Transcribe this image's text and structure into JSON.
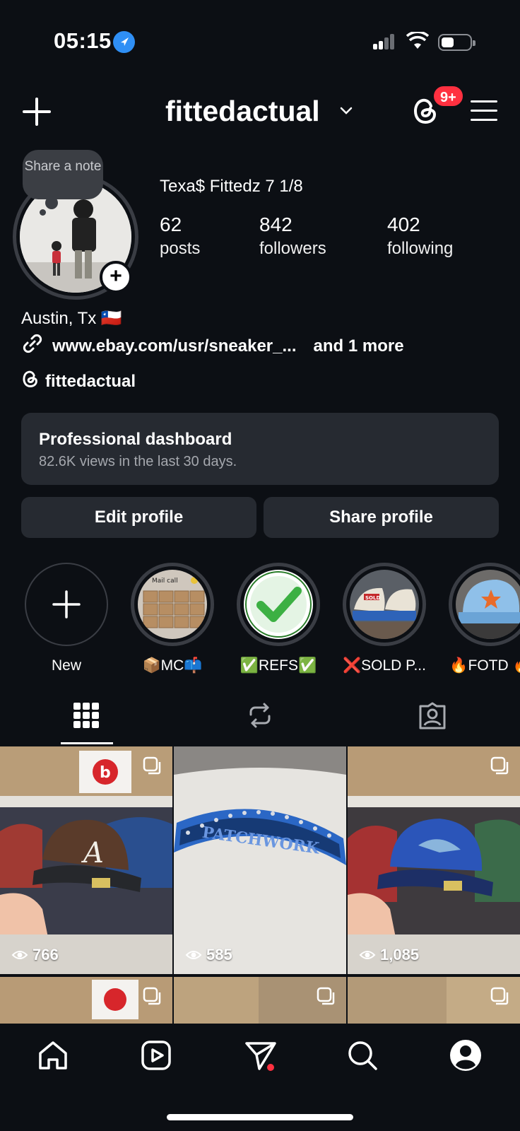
{
  "status_bar": {
    "time": "05:15"
  },
  "header": {
    "username": "fittedactual",
    "notification_badge": "9+"
  },
  "profile": {
    "note_bubble": "Share a note",
    "display_name": "Texa$ Fittedz 7 1/8",
    "stats": [
      {
        "value": "62",
        "label": "posts"
      },
      {
        "value": "842",
        "label": "followers"
      },
      {
        "value": "402",
        "label": "following"
      }
    ],
    "location": "Austin, Tx 🇨🇱",
    "link": "www.ebay.com/usr/sneaker_...",
    "link_more": "and 1 more",
    "threads_handle": "fittedactual"
  },
  "dashboard": {
    "title": "Professional dashboard",
    "subtitle": "82.6K views in the last 30 days."
  },
  "buttons": {
    "edit": "Edit profile",
    "share": "Share profile"
  },
  "highlights": [
    {
      "label": "New"
    },
    {
      "label": "📦MC📫"
    },
    {
      "label": "✅REFS✅"
    },
    {
      "label": "❌SOLD P..."
    },
    {
      "label": "🔥FOTD 🔥"
    }
  ],
  "posts": [
    {
      "views": "766"
    },
    {
      "views": "585"
    },
    {
      "views": "1,085"
    }
  ],
  "tiles": {
    "patch_text": "PATCHWORK",
    "sold_tag": "SOLD",
    "mail_call": "Mail call"
  },
  "colors": {
    "accent_blue": "#2f8ff5",
    "badge_red": "#ff3040",
    "bg": "#0c0f14",
    "card": "#262a31"
  }
}
